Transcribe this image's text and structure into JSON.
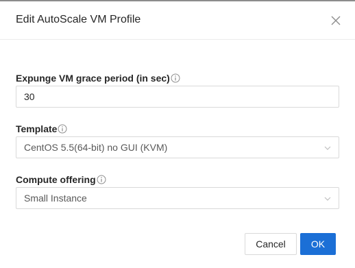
{
  "dialog": {
    "title": "Edit AutoScale VM Profile"
  },
  "form": {
    "expunge": {
      "label": "Expunge VM grace period (in sec)",
      "value": "30"
    },
    "template": {
      "label": "Template",
      "selected": "CentOS 5.5(64-bit) no GUI (KVM)"
    },
    "compute": {
      "label": "Compute offering",
      "selected": "Small Instance"
    }
  },
  "footer": {
    "cancel_label": "Cancel",
    "ok_label": "OK"
  },
  "icons": {
    "close": "close-icon",
    "info": "info-circle-icon",
    "dropdown": "chevron-down-icon"
  },
  "colors": {
    "primary": "#1b6fd6",
    "border": "#d9d9d9"
  }
}
